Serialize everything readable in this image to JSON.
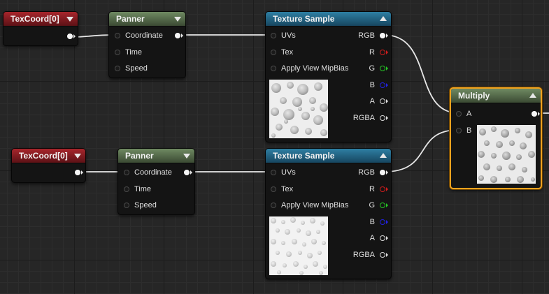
{
  "graph": {
    "texcoord_top": {
      "title": "TexCoord[0]"
    },
    "panner_top": {
      "title": "Panner",
      "pins": {
        "coordinate": "Coordinate",
        "time": "Time",
        "speed": "Speed"
      }
    },
    "sample_top": {
      "title": "Texture Sample",
      "inputs": {
        "uvs": "UVs",
        "tex": "Tex",
        "mip": "Apply View MipBias"
      },
      "outputs": {
        "rgb": "RGB",
        "r": "R",
        "g": "G",
        "b": "B",
        "a": "A",
        "rgba": "RGBA"
      }
    },
    "texcoord_bottom": {
      "title": "TexCoord[0]"
    },
    "panner_bottom": {
      "title": "Panner",
      "pins": {
        "coordinate": "Coordinate",
        "time": "Time",
        "speed": "Speed"
      }
    },
    "sample_bottom": {
      "title": "Texture Sample",
      "inputs": {
        "uvs": "UVs",
        "tex": "Tex",
        "mip": "Apply View MipBias"
      },
      "outputs": {
        "rgb": "RGB",
        "r": "R",
        "g": "G",
        "b": "B",
        "a": "A",
        "rgba": "RGBA"
      }
    },
    "multiply": {
      "title": "Multiply",
      "inputs": {
        "a": "A",
        "b": "B"
      }
    }
  },
  "colors": {
    "texcoord_header": "#a8262c",
    "panner_header": "#6f8a62",
    "texture_header": "#2e7fa3",
    "selection_outline": "#f0a21e",
    "pin_r": "#d11c1c",
    "pin_g": "#25c425",
    "pin_b": "#2222e0"
  },
  "icons": {
    "collapse_down": "chevron-down-icon",
    "collapse_up": "chevron-up-icon",
    "pin_connected": "filled-circle-icon",
    "pin_unconnected": "hollow-circle-icon"
  }
}
